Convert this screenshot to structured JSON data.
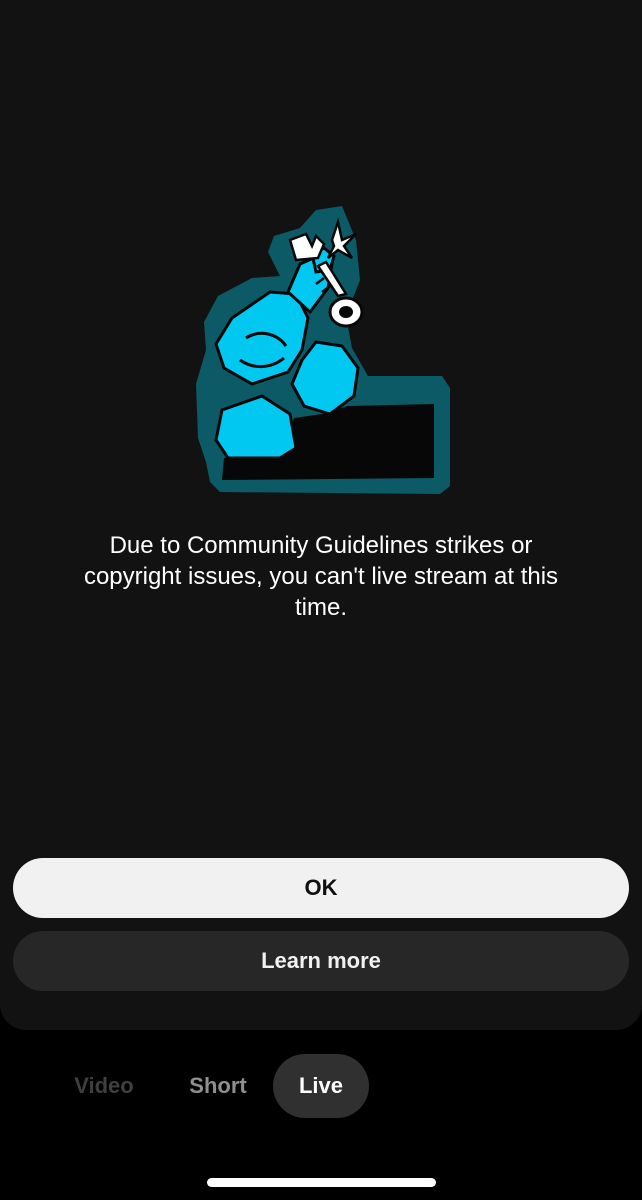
{
  "dialog": {
    "message": "Due to Community Guidelines strikes or copyright issues, you can't live stream at this time.",
    "ok_label": "OK",
    "learn_more_label": "Learn more"
  },
  "illustration": {
    "icon": "locked-person-with-key-illustration",
    "colors": {
      "accent": "#00c8f0",
      "outline": "#0c5a66",
      "dark": "#070707",
      "key": "#ffffff"
    }
  },
  "mode_switcher": {
    "items": [
      {
        "label": "Video",
        "selected": false
      },
      {
        "label": "Short",
        "selected": false
      },
      {
        "label": "Live",
        "selected": true
      }
    ]
  },
  "colors": {
    "sheet_background": "#121212",
    "page_background": "#000000",
    "primary_button": "#f1f1f1",
    "secondary_button": "#272727",
    "selected_mode_pill": "#303030"
  }
}
